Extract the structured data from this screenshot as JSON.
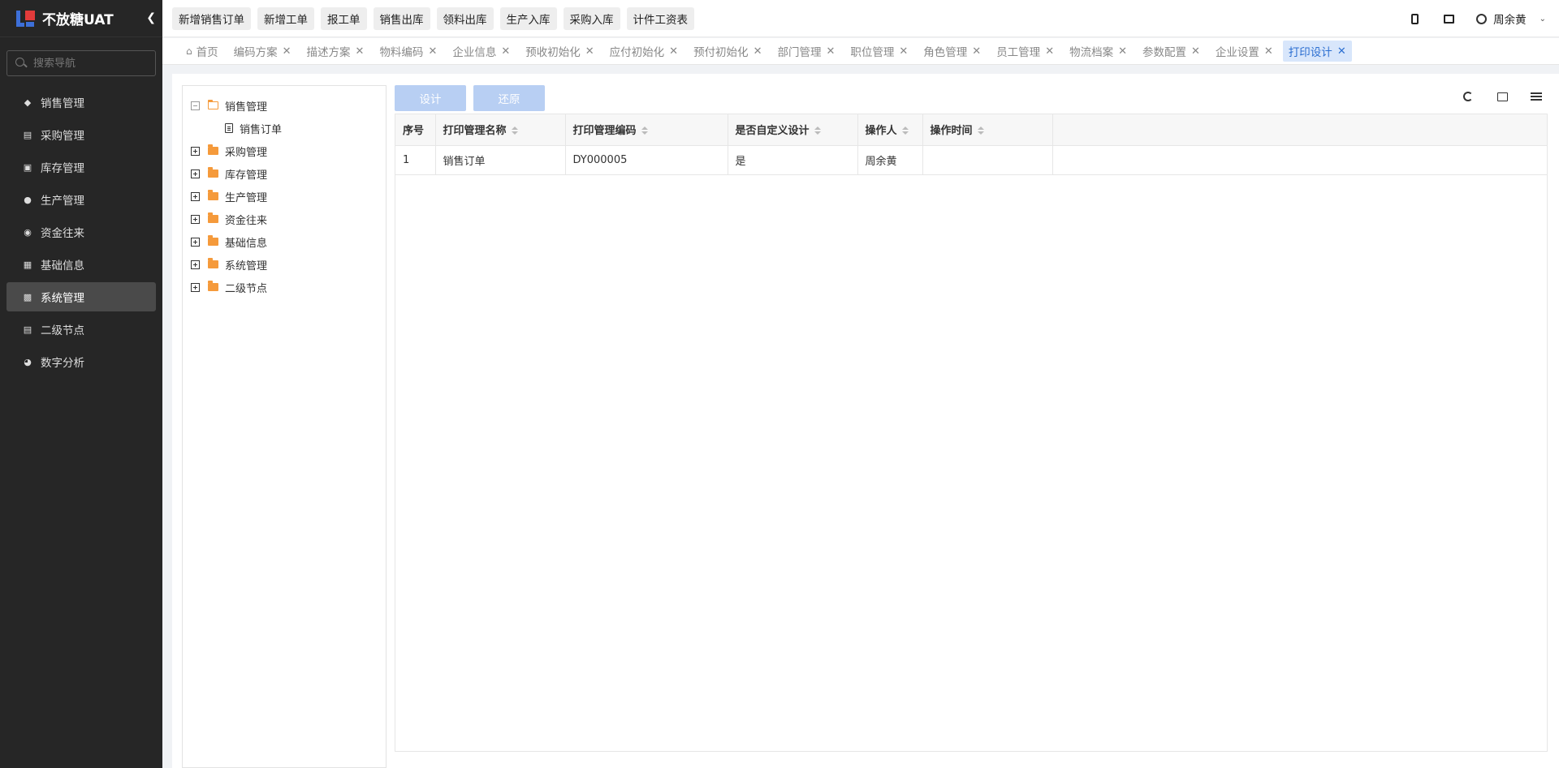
{
  "app": {
    "title": "不放糖UAT",
    "collapse_icon": "chevron-left-icon"
  },
  "sidebar": {
    "search_placeholder": "搜索导航",
    "items": [
      {
        "label": "销售管理",
        "icon": "tag-icon"
      },
      {
        "label": "采购管理",
        "icon": "cart-icon"
      },
      {
        "label": "库存管理",
        "icon": "warehouse-icon"
      },
      {
        "label": "生产管理",
        "icon": "production-icon"
      },
      {
        "label": "资金往来",
        "icon": "money-icon"
      },
      {
        "label": "基础信息",
        "icon": "info-icon"
      },
      {
        "label": "系统管理",
        "icon": "apps-icon",
        "active": true
      },
      {
        "label": "二级节点",
        "icon": "doc-icon"
      },
      {
        "label": "数字分析",
        "icon": "pie-icon"
      }
    ]
  },
  "topbar": {
    "quick_buttons": [
      "新增销售订单",
      "新增工单",
      "报工单",
      "销售出库",
      "领料出库",
      "生产入库",
      "采购入库",
      "计件工资表"
    ],
    "user_name": "周余黄"
  },
  "tabs": [
    {
      "label": "首页",
      "closable": false
    },
    {
      "label": "编码方案"
    },
    {
      "label": "描述方案"
    },
    {
      "label": "物料编码"
    },
    {
      "label": "企业信息"
    },
    {
      "label": "预收初始化"
    },
    {
      "label": "应付初始化"
    },
    {
      "label": "预付初始化"
    },
    {
      "label": "部门管理"
    },
    {
      "label": "职位管理"
    },
    {
      "label": "角色管理"
    },
    {
      "label": "员工管理"
    },
    {
      "label": "物流档案"
    },
    {
      "label": "参数配置"
    },
    {
      "label": "企业设置"
    },
    {
      "label": "打印设计",
      "active": true
    }
  ],
  "tree": {
    "nodes": [
      {
        "label": "销售管理",
        "expanded": true,
        "children": [
          {
            "label": "销售订单"
          }
        ]
      },
      {
        "label": "采购管理"
      },
      {
        "label": "库存管理"
      },
      {
        "label": "生产管理"
      },
      {
        "label": "资金往来"
      },
      {
        "label": "基础信息"
      },
      {
        "label": "系统管理"
      },
      {
        "label": "二级节点"
      }
    ]
  },
  "toolbar": {
    "design_label": "设计",
    "restore_label": "还原"
  },
  "table": {
    "columns": [
      "序号",
      "打印管理名称",
      "打印管理编码",
      "是否自定义设计",
      "操作人",
      "操作时间"
    ],
    "rows": [
      [
        "1",
        "销售订单",
        "DY000005",
        "是",
        "周余黄",
        ""
      ]
    ]
  },
  "colors": {
    "sidebar_bg": "#262626",
    "active_tab_bg": "#d8e6fb",
    "accent": "#2c6fd1",
    "button_disabled": "#b8cff3",
    "folder": "#f59a3b"
  }
}
